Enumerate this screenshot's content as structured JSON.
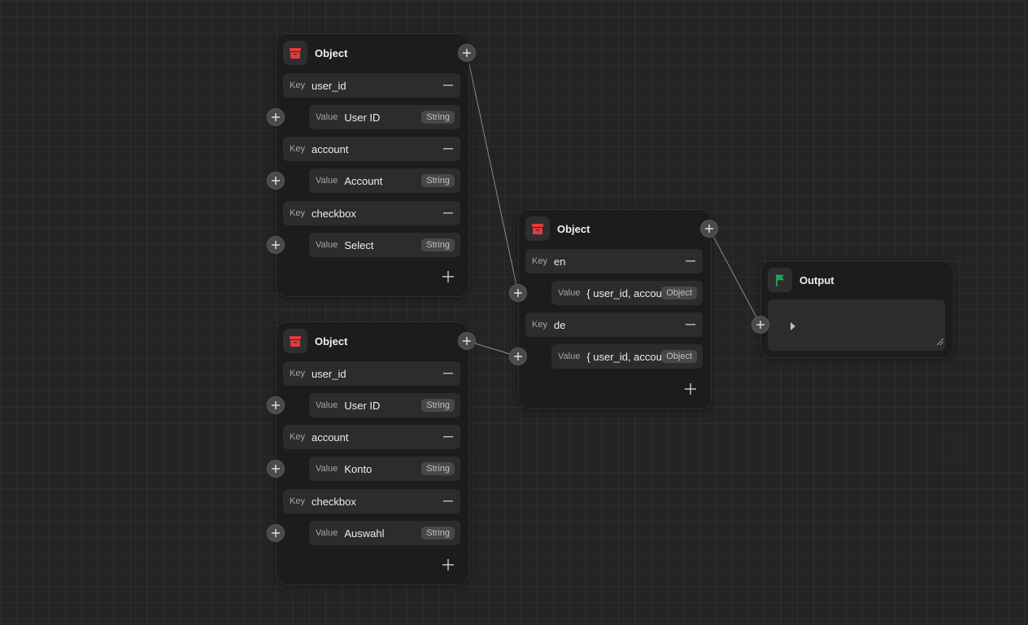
{
  "labels": {
    "key": "Key",
    "value": "Value"
  },
  "colors": {
    "object_icon": "#e23b3b",
    "output_icon": "#23a55a",
    "wire": "#8a8a8a"
  },
  "nodes": {
    "object_en": {
      "title": "Object",
      "icon": "archive-box-icon",
      "fields": [
        {
          "key": "user_id",
          "value": "User ID",
          "type": "String"
        },
        {
          "key": "account",
          "value": "Account",
          "type": "String"
        },
        {
          "key": "checkbox",
          "value": "Select",
          "type": "String"
        }
      ]
    },
    "object_de": {
      "title": "Object",
      "icon": "archive-box-icon",
      "fields": [
        {
          "key": "user_id",
          "value": "User ID",
          "type": "String"
        },
        {
          "key": "account",
          "value": "Konto",
          "type": "String"
        },
        {
          "key": "checkbox",
          "value": "Auswahl",
          "type": "String"
        }
      ]
    },
    "object_locales": {
      "title": "Object",
      "icon": "archive-box-icon",
      "fields": [
        {
          "key": "en",
          "value": "{ user_id, account, checkbox }",
          "type": "Object"
        },
        {
          "key": "de",
          "value": "{ user_id, account, checkbox }",
          "type": "Object"
        }
      ]
    },
    "output": {
      "title": "Output",
      "icon": "flag-icon"
    }
  }
}
